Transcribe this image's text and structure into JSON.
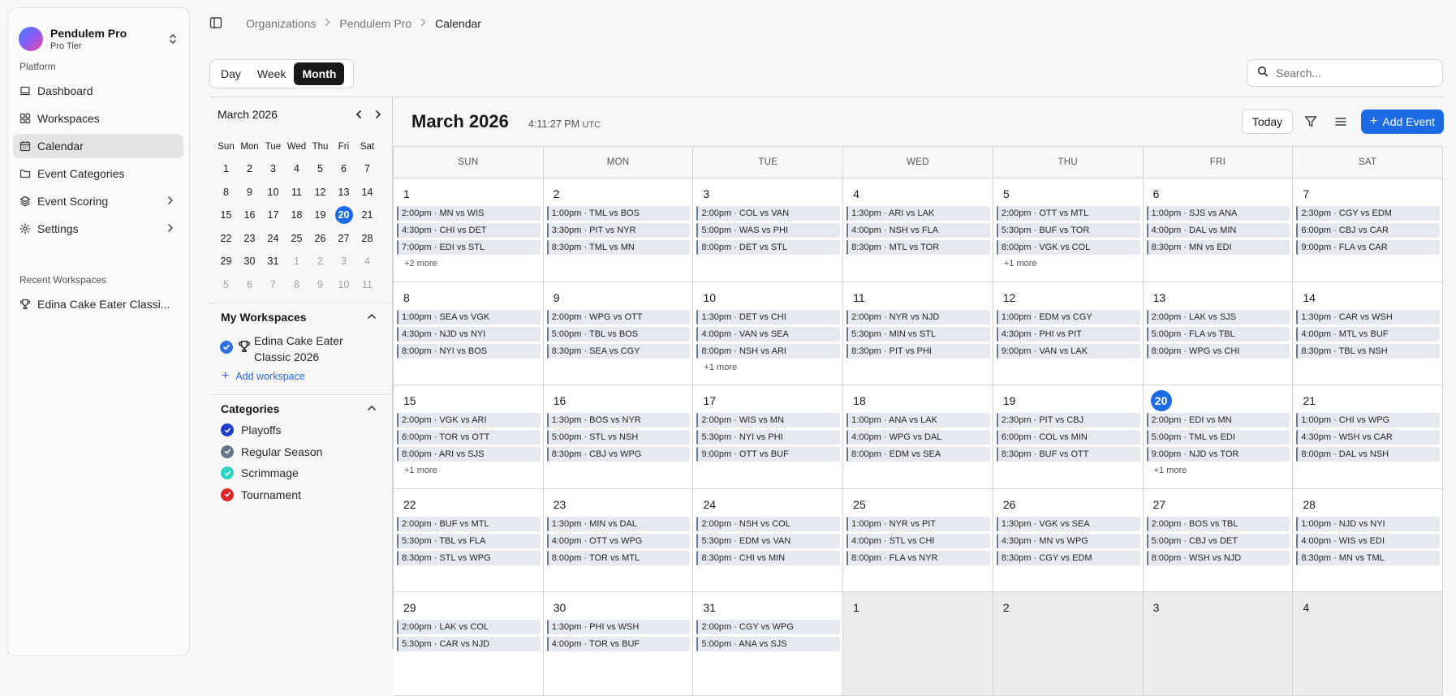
{
  "org": {
    "name": "Pendulem Pro",
    "tier": "Pro Tier"
  },
  "sidebar": {
    "platform_label": "Platform",
    "items": [
      {
        "label": "Dashboard",
        "icon": "laptop-icon"
      },
      {
        "label": "Workspaces",
        "icon": "grid-icon"
      },
      {
        "label": "Calendar",
        "icon": "calendar-icon"
      },
      {
        "label": "Event Categories",
        "icon": "folder-icon"
      },
      {
        "label": "Event Scoring",
        "icon": "layers-icon"
      },
      {
        "label": "Settings",
        "icon": "gear-icon"
      }
    ],
    "recent_label": "Recent Workspaces",
    "recent": [
      {
        "label": "Edina Cake Eater Classi...",
        "icon": "trophy-icon"
      }
    ]
  },
  "breadcrumb": [
    "Organizations",
    "Pendulem Pro",
    "Calendar"
  ],
  "views": [
    "Day",
    "Week",
    "Month"
  ],
  "active_view": "Month",
  "search": {
    "placeholder": "Search..."
  },
  "mini_calendar": {
    "title": "March 2026",
    "weekdays": [
      "Sun",
      "Mon",
      "Tue",
      "Wed",
      "Thu",
      "Fri",
      "Sat"
    ],
    "weeks": [
      [
        "1",
        "2",
        "3",
        "4",
        "5",
        "6",
        "7"
      ],
      [
        "8",
        "9",
        "10",
        "11",
        "12",
        "13",
        "14"
      ],
      [
        "15",
        "16",
        "17",
        "18",
        "19",
        "20",
        "21"
      ],
      [
        "22",
        "23",
        "24",
        "25",
        "26",
        "27",
        "28"
      ],
      [
        "29",
        "30",
        "31",
        "1",
        "2",
        "3",
        "4"
      ],
      [
        "5",
        "6",
        "7",
        "8",
        "9",
        "10",
        "11"
      ]
    ],
    "today": "20"
  },
  "my_workspaces": {
    "title": "My Workspaces",
    "items": [
      {
        "name": "Edina Cake Eater Classic 2026"
      }
    ],
    "add_label": "Add workspace"
  },
  "categories": {
    "title": "Categories",
    "items": [
      {
        "name": "Playoffs",
        "color": "#1e3ec8"
      },
      {
        "name": "Regular Season",
        "color": "#64748b"
      },
      {
        "name": "Scrimmage",
        "color": "#2dd4bf"
      },
      {
        "name": "Tournament",
        "color": "#dc2626"
      }
    ]
  },
  "calendar": {
    "title": "March 2026",
    "time": "4:11:27 PM",
    "tz": "UTC",
    "today_label": "Today",
    "add_label": "Add Event",
    "weekdays": [
      "SUN",
      "MON",
      "TUE",
      "WED",
      "THU",
      "FRI",
      "SAT"
    ],
    "weeks": [
      [
        {
          "d": "1",
          "ev": [
            "2:00pm · MN vs WIS",
            "4:30pm · CHI vs DET",
            "7:00pm · EDI vs STL"
          ],
          "more": "+2 more"
        },
        {
          "d": "2",
          "ev": [
            "1:00pm · TML vs BOS",
            "3:30pm · PIT vs NYR",
            "8:30pm · TML vs MN"
          ]
        },
        {
          "d": "3",
          "ev": [
            "2:00pm · COL vs VAN",
            "5:00pm · WAS vs PHI",
            "8:00pm · DET vs STL"
          ]
        },
        {
          "d": "4",
          "ev": [
            "1:30pm · ARI vs LAK",
            "4:00pm · NSH vs FLA",
            "8:30pm · MTL vs TOR"
          ]
        },
        {
          "d": "5",
          "ev": [
            "2:00pm · OTT vs MTL",
            "5:30pm · BUF vs TOR",
            "8:00pm · VGK vs COL"
          ],
          "more": "+1 more"
        },
        {
          "d": "6",
          "ev": [
            "1:00pm · SJS vs ANA",
            "4:00pm · DAL vs MIN",
            "8:30pm · MN vs EDI"
          ]
        },
        {
          "d": "7",
          "ev": [
            "2:30pm · CGY vs EDM",
            "6:00pm · CBJ vs CAR",
            "9:00pm · FLA vs CAR"
          ]
        }
      ],
      [
        {
          "d": "8",
          "ev": [
            "1:00pm · SEA vs VGK",
            "4:30pm · NJD vs NYI",
            "8:00pm · NYI vs BOS"
          ]
        },
        {
          "d": "9",
          "ev": [
            "2:00pm · WPG vs OTT",
            "5:00pm · TBL vs BOS",
            "8:30pm · SEA vs CGY"
          ]
        },
        {
          "d": "10",
          "ev": [
            "1:30pm · DET vs CHI",
            "4:00pm · VAN vs SEA",
            "8:00pm · NSH vs ARI"
          ],
          "more": "+1 more"
        },
        {
          "d": "11",
          "ev": [
            "2:00pm · NYR vs NJD",
            "5:30pm · MIN vs STL",
            "8:30pm · PIT vs PHI"
          ]
        },
        {
          "d": "12",
          "ev": [
            "1:00pm · EDM vs CGY",
            "4:30pm · PHI vs PIT",
            "9:00pm · VAN vs LAK"
          ]
        },
        {
          "d": "13",
          "ev": [
            "2:00pm · LAK vs SJS",
            "5:00pm · FLA vs TBL",
            "8:00pm · WPG vs CHI"
          ]
        },
        {
          "d": "14",
          "ev": [
            "1:30pm · CAR vs WSH",
            "4:00pm · MTL vs BUF",
            "8:30pm · TBL vs NSH"
          ]
        }
      ],
      [
        {
          "d": "15",
          "ev": [
            "2:00pm · VGK vs ARI",
            "6:00pm · TOR vs OTT",
            "8:00pm · ARI vs SJS"
          ],
          "more": "+1 more"
        },
        {
          "d": "16",
          "ev": [
            "1:30pm · BOS vs NYR",
            "5:00pm · STL vs NSH",
            "8:30pm · CBJ vs WPG"
          ]
        },
        {
          "d": "17",
          "ev": [
            "2:00pm · WIS vs MN",
            "5:30pm · NYI vs PHI",
            "9:00pm · OTT vs BUF"
          ]
        },
        {
          "d": "18",
          "ev": [
            "1:00pm · ANA vs LAK",
            "4:00pm · WPG vs DAL",
            "8:00pm · EDM vs SEA"
          ]
        },
        {
          "d": "19",
          "ev": [
            "2:30pm · PIT vs CBJ",
            "6:00pm · COL vs MIN",
            "8:30pm · BUF vs OTT"
          ]
        },
        {
          "d": "20",
          "ev": [
            "2:00pm · EDI vs MN",
            "5:00pm · TML vs EDI",
            "9:00pm · NJD vs TOR"
          ],
          "more": "+1 more",
          "today": true
        },
        {
          "d": "21",
          "ev": [
            "1:00pm · CHI vs WPG",
            "4:30pm · WSH vs CAR",
            "8:00pm · DAL vs NSH"
          ]
        }
      ],
      [
        {
          "d": "22",
          "ev": [
            "2:00pm · BUF vs MTL",
            "5:30pm · TBL vs FLA",
            "8:30pm · STL vs WPG"
          ]
        },
        {
          "d": "23",
          "ev": [
            "1:30pm · MIN vs DAL",
            "4:00pm · OTT vs WPG",
            "8:00pm · TOR vs MTL"
          ]
        },
        {
          "d": "24",
          "ev": [
            "2:00pm · NSH vs COL",
            "5:30pm · EDM vs VAN",
            "8:30pm · CHI vs MIN"
          ]
        },
        {
          "d": "25",
          "ev": [
            "1:00pm · NYR vs PIT",
            "4:00pm · STL vs CHI",
            "8:00pm · FLA vs NYR"
          ]
        },
        {
          "d": "26",
          "ev": [
            "1:30pm · VGK vs SEA",
            "4:30pm · MN vs WPG",
            "8:30pm · CGY vs EDM"
          ]
        },
        {
          "d": "27",
          "ev": [
            "2:00pm · BOS vs TBL",
            "5:00pm · CBJ vs DET",
            "8:00pm · WSH vs NJD"
          ]
        },
        {
          "d": "28",
          "ev": [
            "1:00pm · NJD vs NYI",
            "4:00pm · WIS vs EDI",
            "8:30pm · MN vs TML"
          ]
        }
      ],
      [
        {
          "d": "29",
          "ev": [
            "2:00pm · LAK vs COL",
            "5:30pm · CAR vs NJD"
          ]
        },
        {
          "d": "30",
          "ev": [
            "1:30pm · PHI vs WSH",
            "4:00pm · TOR vs BUF"
          ]
        },
        {
          "d": "31",
          "ev": [
            "2:00pm · CGY vs WPG",
            "5:00pm · ANA vs SJS"
          ]
        },
        {
          "d": "1",
          "ev": [],
          "other": true
        },
        {
          "d": "2",
          "ev": [],
          "other": true
        },
        {
          "d": "3",
          "ev": [],
          "other": true
        },
        {
          "d": "4",
          "ev": [],
          "other": true
        }
      ]
    ]
  }
}
